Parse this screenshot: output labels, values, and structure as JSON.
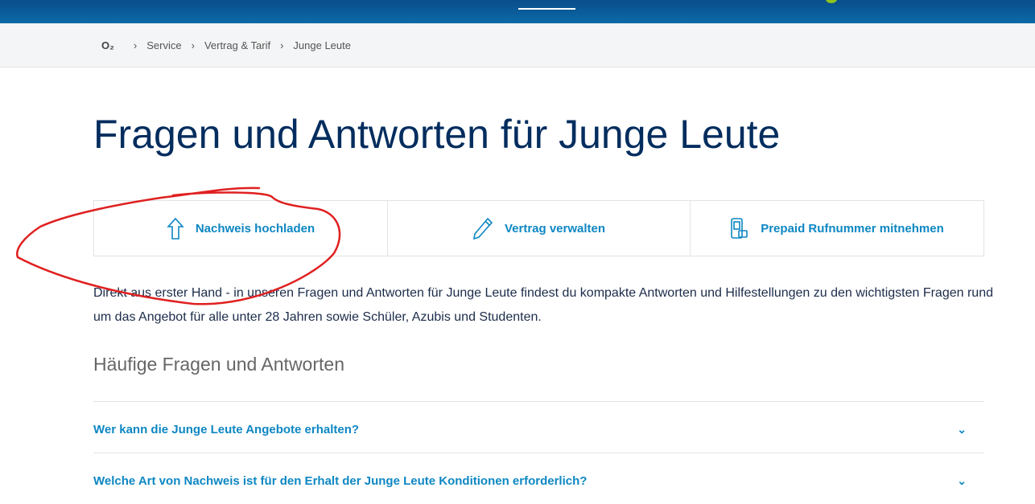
{
  "breadcrumb": {
    "logo": "O₂",
    "items": [
      "Service",
      "Vertrag & Tarif",
      "Junge Leute"
    ]
  },
  "title": "Fragen und Antworten für Junge Leute",
  "tiles": [
    {
      "label": "Nachweis hochladen",
      "icon": "upload-arrow-icon"
    },
    {
      "label": "Vertrag verwalten",
      "icon": "pencil-icon"
    },
    {
      "label": "Prepaid Rufnummer mitnehmen",
      "icon": "phone-transfer-icon"
    }
  ],
  "intro": "Direkt aus erster Hand - in unseren Fragen und Antworten für Junge Leute findest du kompakte Antworten und Hilfestellungen zu den wichtigsten Fragen rund um das Angebot für alle unter 28 Jahren sowie Schüler, Azubis und Studenten.",
  "faq_heading": "Häufige Fragen und Antworten",
  "faqs": [
    "Wer kann die Junge Leute Angebote erhalten?",
    "Welche Art von Nachweis ist für den Erhalt der Junge Leute Konditionen erforderlich?"
  ],
  "colors": {
    "accent": "#0d87c3",
    "title": "#032d5e",
    "annotation": "#e02020"
  }
}
